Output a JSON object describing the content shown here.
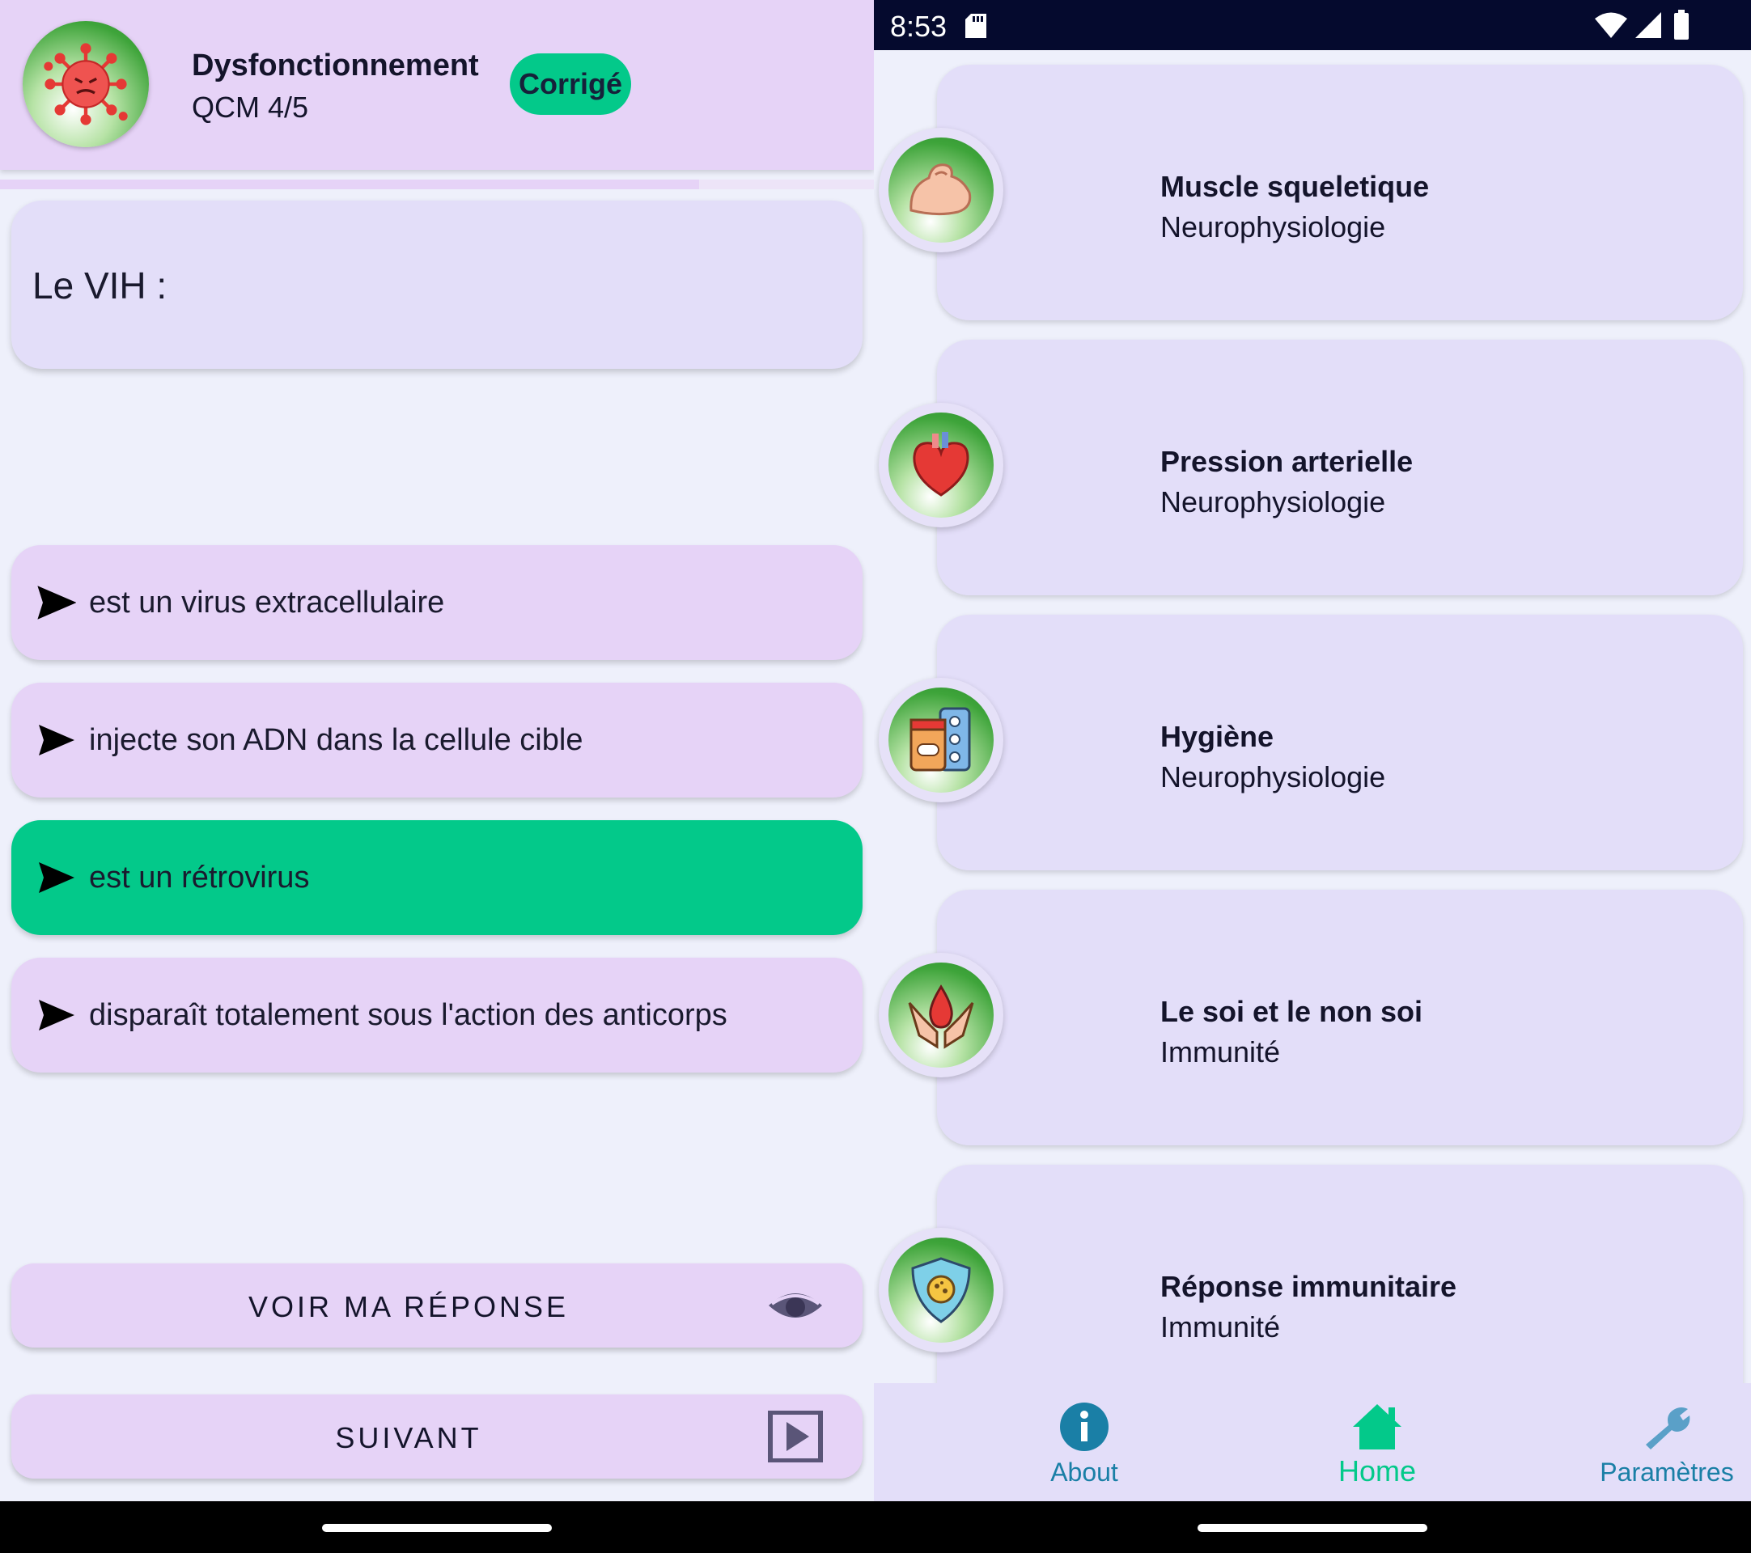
{
  "quiz": {
    "title": "Dysfonctionnement",
    "count": "QCM 4/5",
    "badge": "Corrigé",
    "progress": 0.8,
    "question": "Le VIH :",
    "options": [
      {
        "text": "est un virus extracellulaire",
        "selected": false
      },
      {
        "text": "injecte son ADN dans la cellule cible",
        "selected": false
      },
      {
        "text": "est un rétrovirus",
        "selected": true
      },
      {
        "text": "disparaît totalement sous l'action des anticorps",
        "selected": false
      }
    ],
    "voir_label": "VOIR MA RÉPONSE",
    "suivant_label": "SUIVANT"
  },
  "status": {
    "time": "8:53"
  },
  "topics": [
    {
      "title": "Muscle squeletique",
      "subtitle": "Neurophysiologie",
      "icon": "muscle-icon"
    },
    {
      "title": "Pression arterielle",
      "subtitle": "Neurophysiologie",
      "icon": "heart-icon"
    },
    {
      "title": "Hygiène",
      "subtitle": "Neurophysiologie",
      "icon": "pills-icon"
    },
    {
      "title": "Le soi et le non soi",
      "subtitle": "Immunité",
      "icon": "hands-blood-icon"
    },
    {
      "title": "Réponse immunitaire",
      "subtitle": "Immunité",
      "icon": "shield-virus-icon"
    }
  ],
  "nav": {
    "about": "About",
    "home": "Home",
    "params": "Paramètres"
  },
  "colors": {
    "accent": "#03c98a",
    "card": "#e3def9",
    "header": "#e6d3f7",
    "statusbar": "#050a2e"
  }
}
